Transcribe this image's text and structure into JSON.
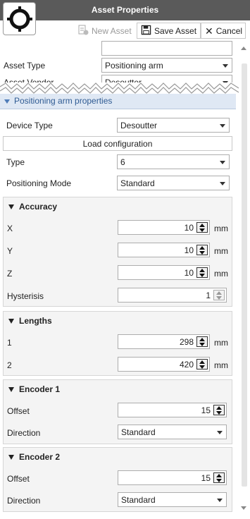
{
  "window": {
    "title": "Asset Properties"
  },
  "toolbar": {
    "new_asset": "New Asset",
    "save_asset": "Save Asset",
    "cancel": "Cancel"
  },
  "asset": {
    "type_label": "Asset Type",
    "type_value": "Positioning arm",
    "vendor_label": "Asset Vendor",
    "vendor_value": "Desoutter"
  },
  "section": {
    "title": "Positioning arm properties"
  },
  "device": {
    "device_type_label": "Device Type",
    "device_type_value": "Desoutter",
    "load_config": "Load configuration",
    "type_label": "Type",
    "type_value": "6",
    "mode_label": "Positioning Mode",
    "mode_value": "Standard"
  },
  "accuracy": {
    "title": "Accuracy",
    "x_label": "X",
    "x_value": "10",
    "x_unit": "mm",
    "y_label": "Y",
    "y_value": "10",
    "y_unit": "mm",
    "z_label": "Z",
    "z_value": "10",
    "z_unit": "mm",
    "hysteresis_label": "Hysterisis",
    "hysteresis_value": "1"
  },
  "lengths": {
    "title": "Lengths",
    "l1_label": "1",
    "l1_value": "298",
    "l1_unit": "mm",
    "l2_label": "2",
    "l2_value": "420",
    "l2_unit": "mm"
  },
  "encoder1": {
    "title": "Encoder 1",
    "offset_label": "Offset",
    "offset_value": "15",
    "direction_label": "Direction",
    "direction_value": "Standard"
  },
  "encoder2": {
    "title": "Encoder 2",
    "offset_label": "Offset",
    "offset_value": "15",
    "direction_label": "Direction",
    "direction_value": "Standard"
  }
}
